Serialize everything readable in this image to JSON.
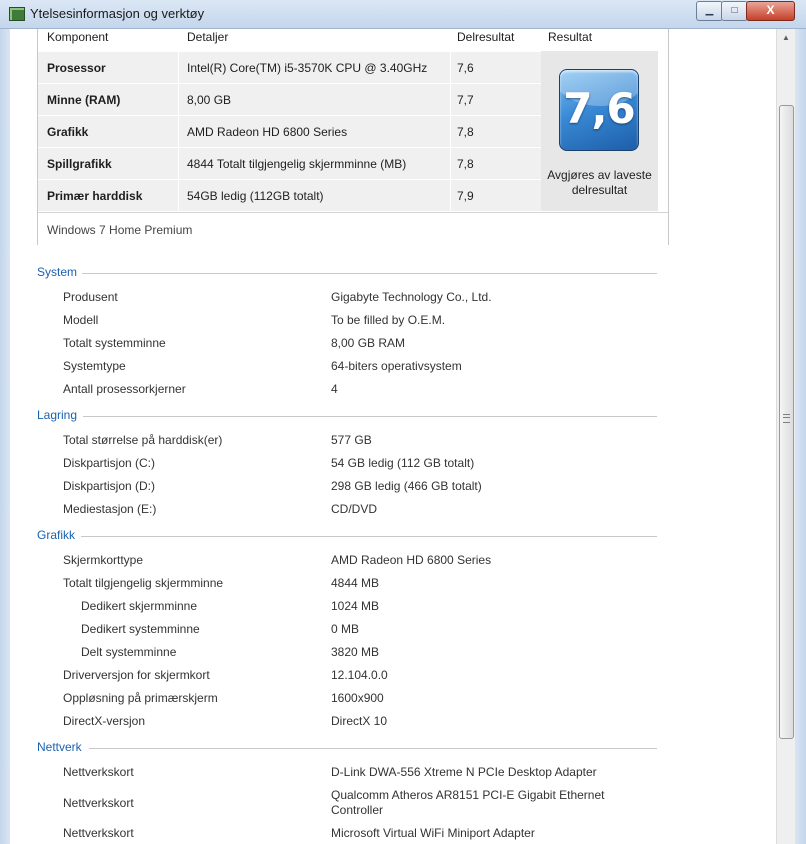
{
  "window": {
    "title": "Ytelsesinformasjon og verktøy",
    "buttons": {
      "minimize": "▁",
      "maximize": "□",
      "close": "X"
    }
  },
  "scores": {
    "headers": [
      "Komponent",
      "Detaljer",
      "Delresultat",
      "Resultat"
    ],
    "rows": [
      {
        "component": "Prosessor",
        "details": "Intel(R) Core(TM) i5-3570K CPU @ 3.40GHz",
        "subscore": "7,6"
      },
      {
        "component": "Minne (RAM)",
        "details": "8,00 GB",
        "subscore": "7,7"
      },
      {
        "component": "Grafikk",
        "details": "AMD Radeon HD 6800 Series",
        "subscore": "7,8"
      },
      {
        "component": "Spillgrafikk",
        "details": "4844 Totalt tilgjengelig skjermminne (MB)",
        "subscore": "7,8"
      },
      {
        "component": "Primær harddisk",
        "details": "54GB ledig (112GB totalt)",
        "subscore": "7,9"
      }
    ],
    "base_score": "7,6",
    "note": "Avgjøres av laveste delresultat",
    "os_edition": "Windows 7 Home Premium"
  },
  "sections": [
    {
      "title": "System",
      "rows": [
        {
          "label": "Produsent",
          "value": "Gigabyte Technology Co., Ltd."
        },
        {
          "label": "Modell",
          "value": "To be filled by O.E.M."
        },
        {
          "label": "Totalt systemminne",
          "value": "8,00 GB RAM"
        },
        {
          "label": "Systemtype",
          "value": "64-biters operativsystem"
        },
        {
          "label": "Antall prosessorkjerner",
          "value": "4"
        }
      ]
    },
    {
      "title": "Lagring",
      "rows": [
        {
          "label": "Total størrelse på harddisk(er)",
          "value": "577 GB"
        },
        {
          "label": "Diskpartisjon (C:)",
          "value": "54 GB ledig (112 GB totalt)"
        },
        {
          "label": "Diskpartisjon (D:)",
          "value": "298 GB ledig (466 GB totalt)"
        },
        {
          "label": "Mediestasjon (E:)",
          "value": "CD/DVD"
        }
      ]
    },
    {
      "title": "Grafikk",
      "rows": [
        {
          "label": "Skjermkorttype",
          "value": "AMD Radeon HD 6800 Series"
        },
        {
          "label": "Totalt tilgjengelig skjermminne",
          "value": "4844 MB"
        },
        {
          "label": "Dedikert skjermminne",
          "value": "1024 MB"
        },
        {
          "label": "Dedikert systemminne",
          "value": "0 MB"
        },
        {
          "label": "Delt systemminne",
          "value": "3820 MB"
        },
        {
          "label": "Driverversjon for skjermkort",
          "value": "12.104.0.0"
        },
        {
          "label": "Oppløsning på primærskjerm",
          "value": "1600x900"
        },
        {
          "label": "DirectX-versjon",
          "value": "DirectX 10"
        }
      ]
    },
    {
      "title": "Nettverk",
      "rows": [
        {
          "label": "Nettverkskort",
          "value": "D-Link DWA-556 Xtreme N PCIe Desktop Adapter"
        },
        {
          "label": "Nettverkskort",
          "value": "Qualcomm Atheros AR8151 PCI-E Gigabit Ethernet Controller"
        },
        {
          "label": "Nettverkskort",
          "value": "Microsoft Virtual WiFi Miniport Adapter"
        }
      ]
    }
  ],
  "scrollbar": {
    "up_arrow": "▲"
  }
}
